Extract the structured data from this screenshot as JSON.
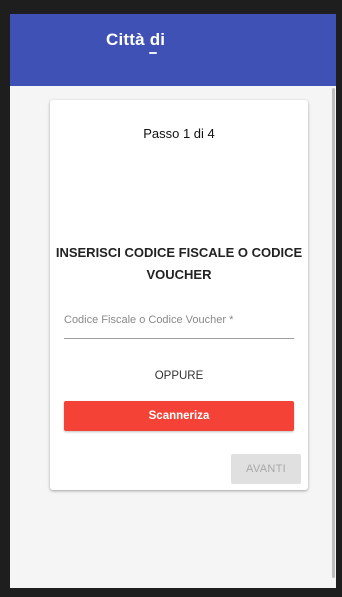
{
  "appbar": {
    "title": "Città di",
    "background_color": "#3f51b5"
  },
  "card": {
    "step_label": "Passo 1 di 4",
    "heading": "INSERISCI CODICE FISCALE O CODICE VOUCHER",
    "input": {
      "label": "Codice Fiscale o Codice Voucher *",
      "value": ""
    },
    "separator_text": "OPPURE",
    "scan_button_label": "Scanneriza",
    "next_button_label": "AVANTI"
  },
  "colors": {
    "primary": "#3f51b5",
    "accent_red": "#f44336",
    "disabled": "#e0e0e0"
  }
}
